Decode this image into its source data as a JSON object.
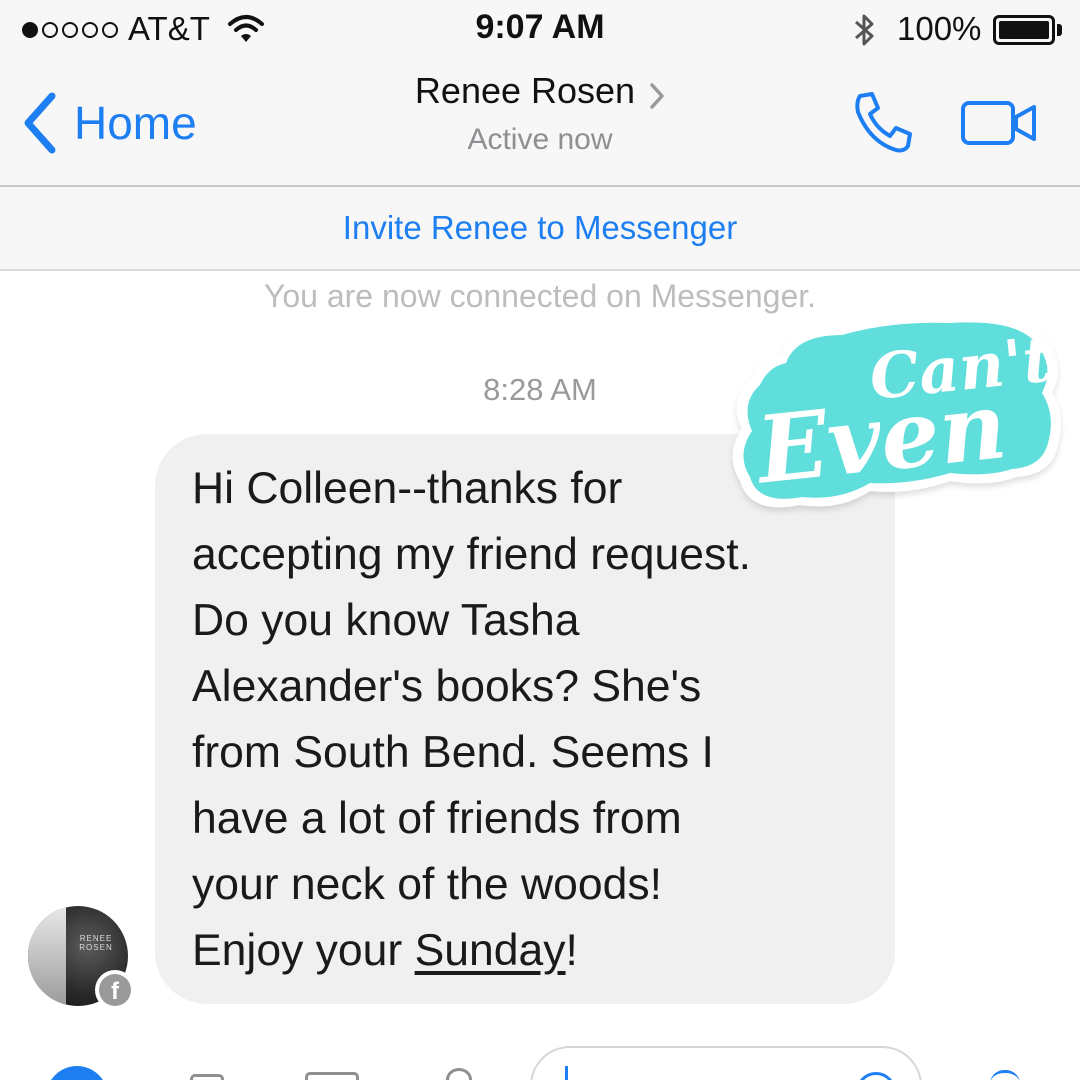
{
  "status_bar": {
    "carrier": "AT&T",
    "time": "9:07 AM",
    "battery": "100%",
    "signal_bars_filled": 1,
    "signal_bars_total": 5
  },
  "nav": {
    "back_label": "Home",
    "contact_name": "Renee Rosen",
    "contact_status": "Active now"
  },
  "banner": {
    "invite_label": "Invite Renee to Messenger"
  },
  "conversation": {
    "system_note": "You are now connected on Messenger.",
    "timestamp": "8:28 AM",
    "message": {
      "lines": [
        "Hi Colleen--thanks for",
        "accepting my friend request.",
        "Do you know Tasha",
        "Alexander's books? She's",
        "from South Bend. Seems I",
        "have a lot of friends from",
        "your neck of the woods!"
      ],
      "last_line_prefix": "Enjoy your ",
      "last_line_link": "Sunday",
      "last_line_suffix": "!"
    },
    "avatar_text": "RENEE ROSEN"
  },
  "sticker": {
    "line1": "Can't",
    "line2": "Even",
    "color": "#5fdedc"
  },
  "colors": {
    "accent": "#1d7ff2",
    "bubble": "#f1f0f0",
    "chrome": "#f7f7f7"
  },
  "icons": {
    "back": "chevron-left-icon",
    "call": "phone-icon",
    "video": "video-camera-icon",
    "wifi": "wifi-icon",
    "bluetooth": "bluetooth-icon",
    "battery": "battery-icon",
    "facebook_badge": "facebook-icon"
  }
}
